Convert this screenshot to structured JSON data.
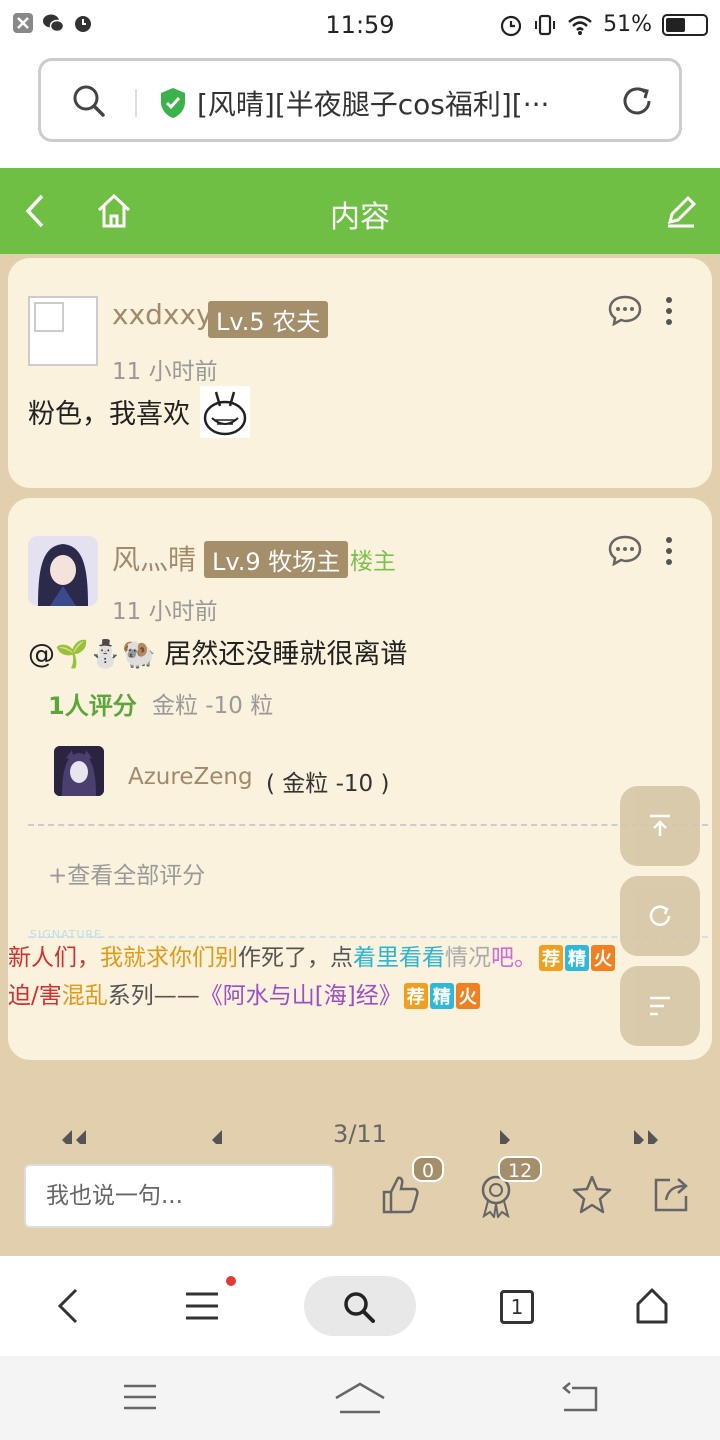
{
  "status_bar": {
    "time": "11:59",
    "battery": "51%",
    "battery_level": 0.51
  },
  "url_bar": {
    "text": "[风晴][半夜腿子cos福利][···"
  },
  "title_bar": {
    "title": "内容"
  },
  "posts": [
    {
      "username": "xxdxxy",
      "level": "Lv.5 农夫",
      "time": "11 小时前",
      "text": "粉色，我喜欢"
    },
    {
      "username": "风灬晴",
      "level": "Lv.9 牧场主",
      "host_tag": "楼主",
      "time": "11 小时前",
      "text": "@🌱⛄🐏 居然还没睡就很离谱",
      "rating_label": "1人评分",
      "rating_gold": "金粒 -10 粒",
      "rater_name": "AzureZeng",
      "rater_value": "( 金粒 -10 )",
      "view_all": "+查看全部评分",
      "signature_label": "SIGNATURE",
      "sig_line1": [
        {
          "text": "新人们，",
          "color": "#d32f2f"
        },
        {
          "text": "我就求你们别",
          "color": "#e09a1a"
        },
        {
          "text": "作死了，点",
          "color": "#555555"
        },
        {
          "text": "着里看看",
          "color": "#29b6d6"
        },
        {
          "text": "情况",
          "color": "#aaaaaa"
        },
        {
          "text": "吧。",
          "color": "#d06bd6"
        }
      ],
      "sig_line2": [
        {
          "text": "迫/害",
          "color": "#d32f2f"
        },
        {
          "text": "混乱",
          "color": "#e09a1a"
        },
        {
          "text": "系列——",
          "color": "#555555"
        },
        {
          "text": "《阿水与山[海]经》",
          "color": "#9c4fc7"
        }
      ],
      "tags": [
        "荐",
        "精",
        "火"
      ]
    }
  ],
  "pager": {
    "text": "3/11"
  },
  "input_bar": {
    "placeholder": "我也说一句...",
    "like_count": "0",
    "award_count": "12"
  },
  "browser_nav": {
    "tab_count": "1"
  }
}
